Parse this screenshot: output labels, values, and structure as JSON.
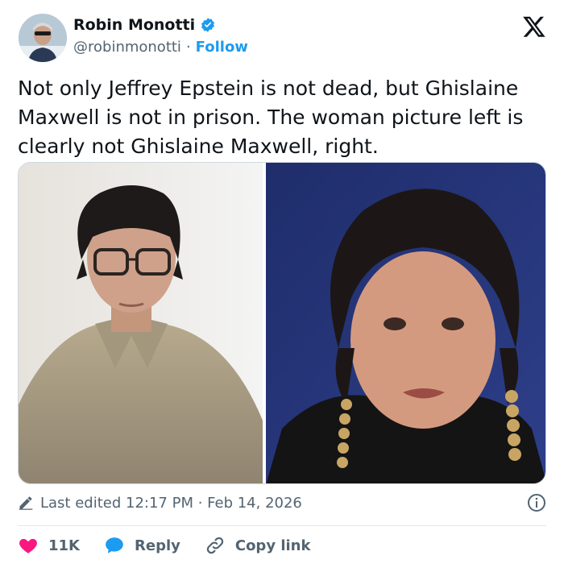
{
  "author": {
    "name": "Robin Monotti",
    "handle": "@robinmonotti",
    "separator": "·",
    "follow_label": "Follow"
  },
  "tweet": {
    "text": "Not only Jeffrey Epstein is not dead, but Ghislaine Maxwell is not in prison. The woman picture left is clearly not Ghislaine Maxwell, right."
  },
  "meta": {
    "edited_label": "Last edited 12:17 PM · Feb 14, 2026"
  },
  "actions": {
    "like_count": "11K",
    "reply_label": "Reply",
    "copy_link_label": "Copy link"
  },
  "colors": {
    "accent": "#1d9bf0",
    "like": "#f91880",
    "text": "#0f1419",
    "muted": "#536471"
  },
  "icons": [
    "verified-badge-icon",
    "x-logo-icon",
    "pencil-icon",
    "info-icon",
    "heart-icon",
    "reply-bubble-icon",
    "link-icon"
  ]
}
